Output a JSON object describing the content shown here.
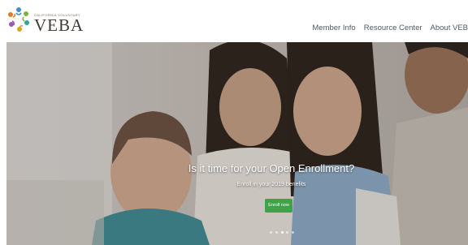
{
  "logo": {
    "small_text": "CALIFORNIA VOLUNTARY",
    "word": "VEBA",
    "colors": [
      "#e07b2e",
      "#3f8fd0",
      "#7bb63c",
      "#d9a326",
      "#9b59b6",
      "#2fa59a"
    ]
  },
  "nav": {
    "items": [
      {
        "label": "Member Info"
      },
      {
        "label": "Resource Center"
      },
      {
        "label": "About VEB"
      }
    ]
  },
  "hero": {
    "title": "Is it time for your Open Enrollment?",
    "subtitle": "Enroll in your 2019 benefits",
    "button_label": "Enroll now",
    "button_color": "#3fa34a",
    "slides_count": 5,
    "active_slide": 2
  }
}
